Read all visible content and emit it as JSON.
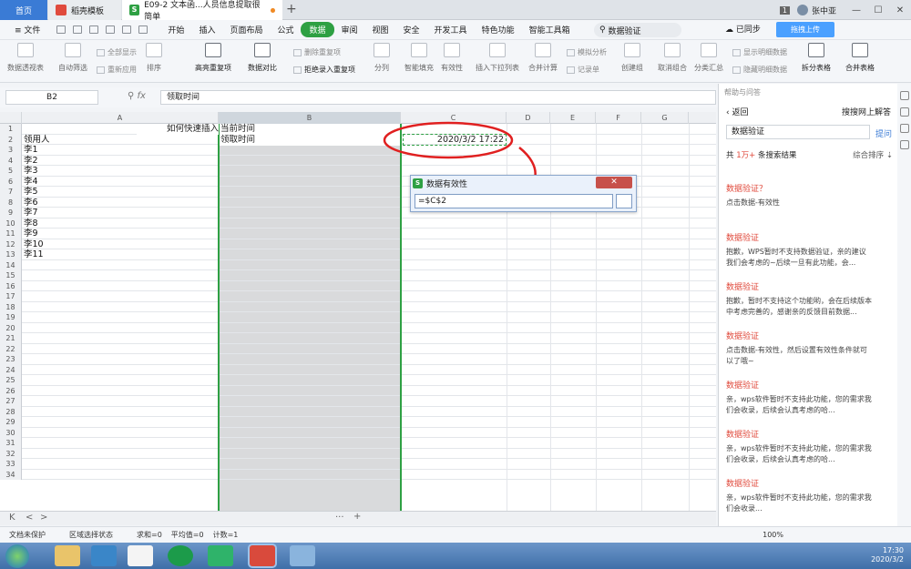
{
  "tabs": {
    "home": "首页",
    "daoke": "稻壳模板",
    "doc": "E09-2 文本函...人员信息提取很简单",
    "user_count": "1",
    "user": "张中亚"
  },
  "menu": {
    "file": "文件",
    "items": [
      "开始",
      "插入",
      "页面布局",
      "公式",
      "数据",
      "审阅",
      "视图",
      "安全",
      "开发工具",
      "特色功能",
      "智能工具箱"
    ],
    "active_index": 4,
    "search": "数据验证",
    "sync": "已同步",
    "cloud": "拖拽上传"
  },
  "ribbon": {
    "buttons": [
      "数据透视表",
      "自动筛选",
      "排序",
      "高亮重复项",
      "数据对比",
      "拒绝录入重复项",
      "分列",
      "智能填充",
      "有效性",
      "插入下拉列表",
      "合并计算",
      "记录单",
      "创建组",
      "取消组合",
      "分类汇总",
      "拆分表格",
      "合并表格"
    ],
    "small": [
      "全部显示",
      "重新应用",
      "删除重复项",
      "模拟分析",
      "显示明细数据",
      "隐藏明细数据"
    ]
  },
  "formula": {
    "namebox": "B2",
    "content": "领取时间"
  },
  "grid": {
    "columns": [
      "A",
      "B",
      "C",
      "D",
      "E",
      "F",
      "G"
    ],
    "a1": "如何快速插入",
    "b1": "当前时间",
    "b2": "领取时间",
    "c2": "2020/3/2 17:22",
    "colA": [
      "领用人",
      "李1",
      "李2",
      "李3",
      "李4",
      "李5",
      "李6",
      "李7",
      "李8",
      "李9",
      "李10",
      "李11"
    ]
  },
  "dialog": {
    "title": "数据有效性",
    "value": "=$C$2"
  },
  "status": {
    "protect": "文档未保护",
    "select": "区域选择状态",
    "sum": "求和=0",
    "avg": "平均值=0",
    "count": "计数=1",
    "zoom": "100%"
  },
  "panel": {
    "header": "帮助与问答",
    "back": "返回",
    "web": "搜搜网上解答",
    "query": "数据验证",
    "ask": "提问",
    "count_prefix": "共",
    "count_num": "1万+",
    "count_suffix": "条搜索结果",
    "sort": "综合排序",
    "results": [
      {
        "title": "数据验证？",
        "desc": "点击数据-有效性"
      },
      {
        "title": "数据验证",
        "desc": "抱歉，WPS暂时不支持数据验证，亲的建议我们会考虑的~后续一旦有此功能，会..."
      },
      {
        "title": "数据验证",
        "desc": "抱歉，暂时不支持这个功能哟，会在后续版本中考虑完善的，感谢亲的反馈目前数据..."
      },
      {
        "title": "数据验证",
        "desc": "点击数据-有效性，然后设置有效性条件就可以了哦~"
      },
      {
        "title": "数据验证",
        "desc": "亲，wps软件暂时不支持此功能，您的需求我们会收录，后续会认真考虑的哈..."
      },
      {
        "title": "数据验证",
        "desc": "亲，wps软件暂时不支持此功能，您的需求我们会收录，后续会认真考虑的哈..."
      },
      {
        "title": "数据验证",
        "desc": "亲，wps软件暂时不支持此功能，您的需求我们会收录..."
      }
    ]
  },
  "taskbar": {
    "time": "17:30",
    "date": "2020/3/2"
  }
}
